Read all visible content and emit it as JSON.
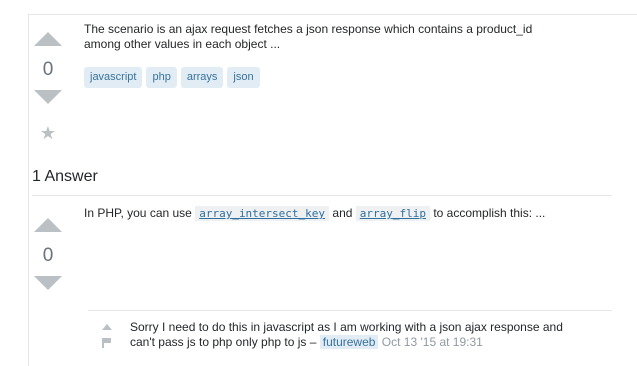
{
  "question": {
    "votes": "0",
    "excerpt_line1": "The scenario is an ajax request fetches a json response which contains a product_id",
    "excerpt_line2": "among other values in each object ...",
    "tags": [
      "javascript",
      "php",
      "arrays",
      "json"
    ]
  },
  "answers": {
    "header": "1 Answer"
  },
  "answer": {
    "votes": "0",
    "text_prefix": "In PHP, you can use",
    "code1": "array_intersect_key",
    "text_mid": "and",
    "code2": "array_flip",
    "text_suffix": "to accomplish this: ..."
  },
  "comment": {
    "line1": "Sorry I need to do this in javascript as I am working with a json ajax response and",
    "line2": "can't pass js to php only php to js –",
    "user": "futureweb",
    "date": "Oct 13 '15 at 19:31"
  },
  "colors": {
    "tag_bg": "#e1ecf4",
    "tag_fg": "#39739d",
    "arrow": "#bbc0c4"
  }
}
